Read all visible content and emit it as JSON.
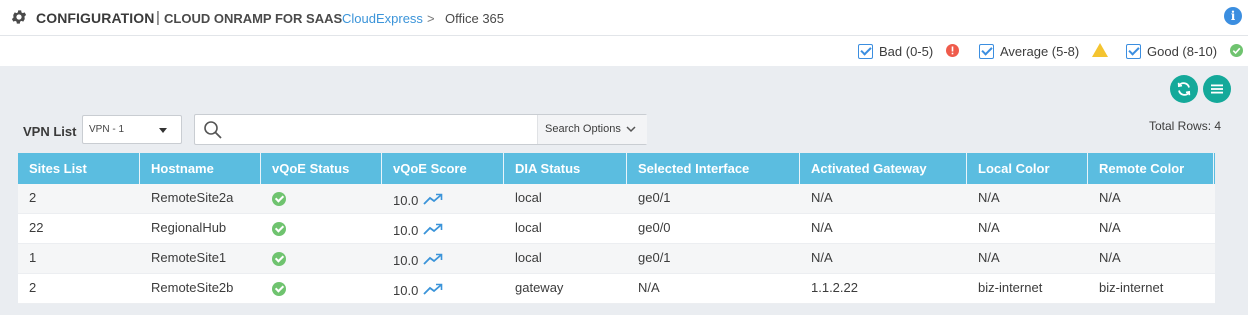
{
  "header": {
    "title": "CONFIGURATION",
    "separator": "|",
    "subtitle": "CLOUD ONRAMP FOR SAAS",
    "breadcrumb_link": "CloudExpress",
    "breadcrumb_sep": ">",
    "breadcrumb_current": "Office 365",
    "info_label": "i"
  },
  "legend": [
    {
      "label": "Bad (0-5)",
      "checked": true,
      "color": "#ef5b4b",
      "icon": "error-icon"
    },
    {
      "label": "Average (5-8)",
      "checked": true,
      "color": "#f4c430",
      "icon": "warning-icon"
    },
    {
      "label": "Good (8-10)",
      "checked": true,
      "color": "#6fc36f",
      "icon": "check-icon"
    }
  ],
  "toolbar": {
    "refresh_icon": "refresh-icon",
    "menu_icon": "menu-icon",
    "accent_color": "#14a99a"
  },
  "vpn": {
    "label": "VPN List",
    "selected": "VPN - 1"
  },
  "search": {
    "placeholder": "",
    "options_label": "Search Options"
  },
  "total_rows": "Total Rows: 4",
  "table": {
    "header_color": "#5bbde0",
    "columns": [
      "Sites List",
      "Hostname",
      "vQoE Status",
      "vQoE Score",
      "DIA Status",
      "Selected Interface",
      "Activated Gateway",
      "Local Color",
      "Remote Color"
    ],
    "rows": [
      {
        "site": "2",
        "hostname": "RemoteSite2a",
        "status": "good",
        "score": "10.0",
        "dia": "local",
        "interface": "ge0/1",
        "gateway": "N/A",
        "local_color": "N/A",
        "remote_color": "N/A"
      },
      {
        "site": "22",
        "hostname": "RegionalHub",
        "status": "good",
        "score": "10.0",
        "dia": "local",
        "interface": "ge0/0",
        "gateway": "N/A",
        "local_color": "N/A",
        "remote_color": "N/A"
      },
      {
        "site": "1",
        "hostname": "RemoteSite1",
        "status": "good",
        "score": "10.0",
        "dia": "local",
        "interface": "ge0/1",
        "gateway": "N/A",
        "local_color": "N/A",
        "remote_color": "N/A"
      },
      {
        "site": "2",
        "hostname": "RemoteSite2b",
        "status": "good",
        "score": "10.0",
        "dia": "gateway",
        "interface": "N/A",
        "gateway": "1.1.2.22",
        "local_color": "biz-internet",
        "remote_color": "biz-internet"
      }
    ]
  }
}
